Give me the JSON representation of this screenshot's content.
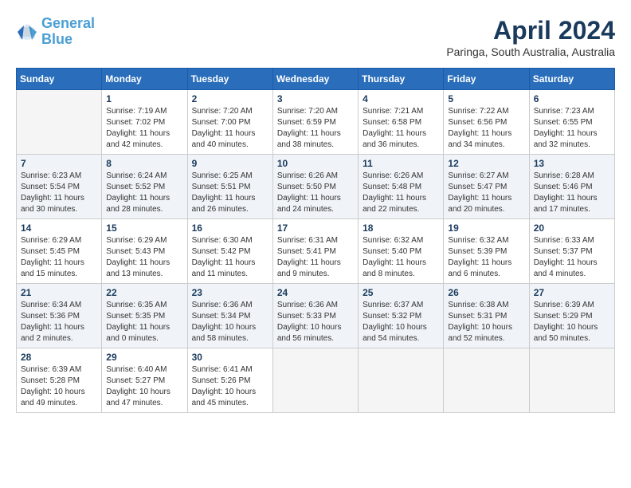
{
  "header": {
    "logo_line1": "General",
    "logo_line2": "Blue",
    "month": "April 2024",
    "location": "Paringa, South Australia, Australia"
  },
  "weekdays": [
    "Sunday",
    "Monday",
    "Tuesday",
    "Wednesday",
    "Thursday",
    "Friday",
    "Saturday"
  ],
  "weeks": [
    [
      {
        "day": "",
        "empty": true
      },
      {
        "day": "1",
        "sunrise": "7:19 AM",
        "sunset": "7:02 PM",
        "daylight": "11 hours and 42 minutes."
      },
      {
        "day": "2",
        "sunrise": "7:20 AM",
        "sunset": "7:00 PM",
        "daylight": "11 hours and 40 minutes."
      },
      {
        "day": "3",
        "sunrise": "7:20 AM",
        "sunset": "6:59 PM",
        "daylight": "11 hours and 38 minutes."
      },
      {
        "day": "4",
        "sunrise": "7:21 AM",
        "sunset": "6:58 PM",
        "daylight": "11 hours and 36 minutes."
      },
      {
        "day": "5",
        "sunrise": "7:22 AM",
        "sunset": "6:56 PM",
        "daylight": "11 hours and 34 minutes."
      },
      {
        "day": "6",
        "sunrise": "7:23 AM",
        "sunset": "6:55 PM",
        "daylight": "11 hours and 32 minutes."
      }
    ],
    [
      {
        "day": "7",
        "sunrise": "6:23 AM",
        "sunset": "5:54 PM",
        "daylight": "11 hours and 30 minutes."
      },
      {
        "day": "8",
        "sunrise": "6:24 AM",
        "sunset": "5:52 PM",
        "daylight": "11 hours and 28 minutes."
      },
      {
        "day": "9",
        "sunrise": "6:25 AM",
        "sunset": "5:51 PM",
        "daylight": "11 hours and 26 minutes."
      },
      {
        "day": "10",
        "sunrise": "6:26 AM",
        "sunset": "5:50 PM",
        "daylight": "11 hours and 24 minutes."
      },
      {
        "day": "11",
        "sunrise": "6:26 AM",
        "sunset": "5:48 PM",
        "daylight": "11 hours and 22 minutes."
      },
      {
        "day": "12",
        "sunrise": "6:27 AM",
        "sunset": "5:47 PM",
        "daylight": "11 hours and 20 minutes."
      },
      {
        "day": "13",
        "sunrise": "6:28 AM",
        "sunset": "5:46 PM",
        "daylight": "11 hours and 17 minutes."
      }
    ],
    [
      {
        "day": "14",
        "sunrise": "6:29 AM",
        "sunset": "5:45 PM",
        "daylight": "11 hours and 15 minutes."
      },
      {
        "day": "15",
        "sunrise": "6:29 AM",
        "sunset": "5:43 PM",
        "daylight": "11 hours and 13 minutes."
      },
      {
        "day": "16",
        "sunrise": "6:30 AM",
        "sunset": "5:42 PM",
        "daylight": "11 hours and 11 minutes."
      },
      {
        "day": "17",
        "sunrise": "6:31 AM",
        "sunset": "5:41 PM",
        "daylight": "11 hours and 9 minutes."
      },
      {
        "day": "18",
        "sunrise": "6:32 AM",
        "sunset": "5:40 PM",
        "daylight": "11 hours and 8 minutes."
      },
      {
        "day": "19",
        "sunrise": "6:32 AM",
        "sunset": "5:39 PM",
        "daylight": "11 hours and 6 minutes."
      },
      {
        "day": "20",
        "sunrise": "6:33 AM",
        "sunset": "5:37 PM",
        "daylight": "11 hours and 4 minutes."
      }
    ],
    [
      {
        "day": "21",
        "sunrise": "6:34 AM",
        "sunset": "5:36 PM",
        "daylight": "11 hours and 2 minutes."
      },
      {
        "day": "22",
        "sunrise": "6:35 AM",
        "sunset": "5:35 PM",
        "daylight": "11 hours and 0 minutes."
      },
      {
        "day": "23",
        "sunrise": "6:36 AM",
        "sunset": "5:34 PM",
        "daylight": "10 hours and 58 minutes."
      },
      {
        "day": "24",
        "sunrise": "6:36 AM",
        "sunset": "5:33 PM",
        "daylight": "10 hours and 56 minutes."
      },
      {
        "day": "25",
        "sunrise": "6:37 AM",
        "sunset": "5:32 PM",
        "daylight": "10 hours and 54 minutes."
      },
      {
        "day": "26",
        "sunrise": "6:38 AM",
        "sunset": "5:31 PM",
        "daylight": "10 hours and 52 minutes."
      },
      {
        "day": "27",
        "sunrise": "6:39 AM",
        "sunset": "5:29 PM",
        "daylight": "10 hours and 50 minutes."
      }
    ],
    [
      {
        "day": "28",
        "sunrise": "6:39 AM",
        "sunset": "5:28 PM",
        "daylight": "10 hours and 49 minutes."
      },
      {
        "day": "29",
        "sunrise": "6:40 AM",
        "sunset": "5:27 PM",
        "daylight": "10 hours and 47 minutes."
      },
      {
        "day": "30",
        "sunrise": "6:41 AM",
        "sunset": "5:26 PM",
        "daylight": "10 hours and 45 minutes."
      },
      {
        "day": "",
        "empty": true
      },
      {
        "day": "",
        "empty": true
      },
      {
        "day": "",
        "empty": true
      },
      {
        "day": "",
        "empty": true
      }
    ]
  ]
}
